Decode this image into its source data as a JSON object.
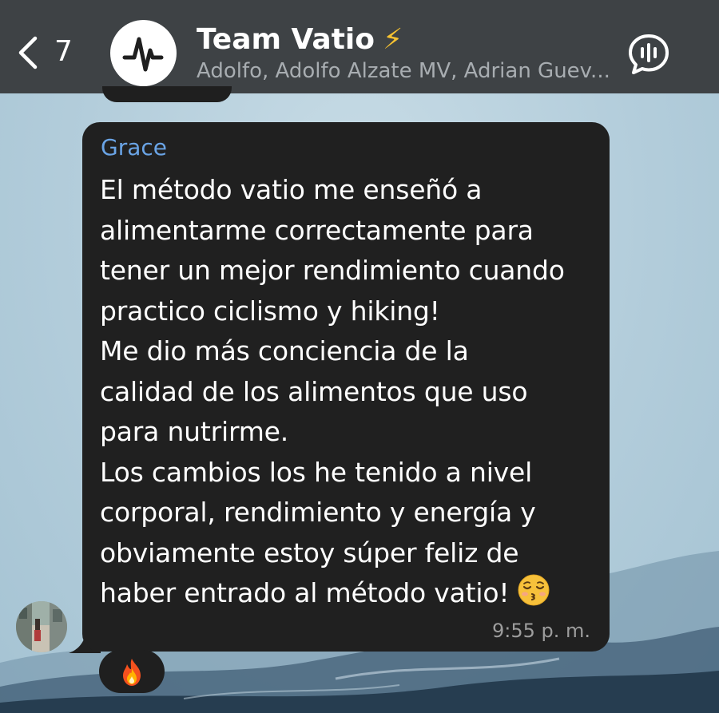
{
  "header": {
    "back_count": "7",
    "title": "Team Vatio",
    "title_emoji": "⚡",
    "members_subtitle": "Adolfo, Adolfo Alzate MV, Adrian Guev...",
    "avatar_icon": "vatio-logo-icon",
    "voice_icon": "voice-chat-icon"
  },
  "message": {
    "sender": "Grace",
    "text": "El método vatio me enseñó a\nalimentarme correctamente para\ntener un mejor rendimiento cuando\npractico ciclismo y hiking!\nMe dio más conciencia de la\ncalidad de los alimentos que uso\npara nutrirme.\nLos cambios los he tenido a nivel\ncorporal, rendimiento y energía y\nobviamente estoy súper feliz de\nhaber entrado al método vatio!",
    "trailing_emoji": "kissing-face-closed-eyes-icon",
    "time": "9:55 p. m.",
    "reaction": "fire-icon"
  },
  "colors": {
    "header_bg": "#3e4245",
    "bubble_bg": "#202020",
    "sender_name": "#6aa4e6",
    "accent_bolt": "#f6c231"
  }
}
